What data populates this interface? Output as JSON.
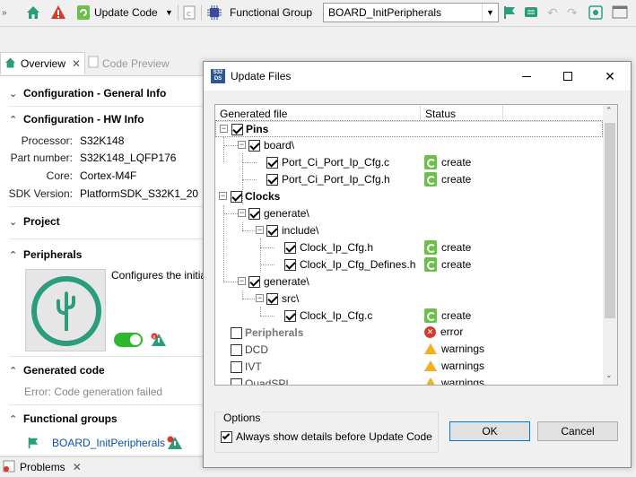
{
  "toolbar": {
    "update_code_label": "Update Code",
    "functional_group_label": "Functional Group",
    "functional_group_value": "BOARD_InitPeripherals"
  },
  "editor_tabs": {
    "overview": "Overview",
    "code_preview": "Code Preview"
  },
  "overview": {
    "sections": {
      "general_info": "Configuration - General Info",
      "hw_info": "Configuration - HW Info",
      "project": "Project",
      "peripherals": "Peripherals",
      "generated_code": "Generated code",
      "functional_groups": "Functional groups"
    },
    "hw_info": [
      {
        "key": "Processor:",
        "value": "S32K148"
      },
      {
        "key": "Part number:",
        "value": "S32K148_LQFP176"
      },
      {
        "key": "Core:",
        "value": "Cortex-M4F"
      },
      {
        "key": "SDK Version:",
        "value": "PlatformSDK_S32K1_20"
      }
    ],
    "peripherals_desc": "Configures the initia",
    "generated_code_status": "Error: Code generation failed",
    "functional_group_item": "BOARD_InitPeripherals",
    "peripherals_toggle_on": true
  },
  "bottom_tab": {
    "problems": "Problems"
  },
  "dialog": {
    "title": "Update Files",
    "app_icon_text": "S32 DS",
    "columns": {
      "file": "Generated file",
      "status": "Status"
    },
    "rows": [
      {
        "label": "Pins",
        "bold": true,
        "checked": true,
        "status": "",
        "kind": ""
      },
      {
        "label": "board\\",
        "bold": false,
        "checked": true,
        "status": "",
        "kind": ""
      },
      {
        "label": "Port_Ci_Port_Ip_Cfg.c",
        "bold": false,
        "checked": true,
        "status": "create",
        "kind": "create"
      },
      {
        "label": "Port_Ci_Port_Ip_Cfg.h",
        "bold": false,
        "checked": true,
        "status": "create",
        "kind": "create"
      },
      {
        "label": "Clocks",
        "bold": true,
        "checked": true,
        "status": "",
        "kind": ""
      },
      {
        "label": "generate\\",
        "bold": false,
        "checked": true,
        "status": "",
        "kind": ""
      },
      {
        "label": "include\\",
        "bold": false,
        "checked": true,
        "status": "",
        "kind": ""
      },
      {
        "label": "Clock_Ip_Cfg.h",
        "bold": false,
        "checked": true,
        "status": "create",
        "kind": "create"
      },
      {
        "label": "Clock_Ip_Cfg_Defines.h",
        "bold": false,
        "checked": true,
        "status": "create",
        "kind": "create"
      },
      {
        "label": "generate\\",
        "bold": false,
        "checked": true,
        "status": "",
        "kind": ""
      },
      {
        "label": "src\\",
        "bold": false,
        "checked": true,
        "status": "",
        "kind": ""
      },
      {
        "label": "Clock_Ip_Cfg.c",
        "bold": false,
        "checked": true,
        "status": "create",
        "kind": "create"
      },
      {
        "label": "Peripherals",
        "bold": true,
        "checked": false,
        "status": "error",
        "kind": "error"
      },
      {
        "label": "DCD",
        "bold": true,
        "checked": false,
        "status": "warnings",
        "kind": "warning"
      },
      {
        "label": "IVT",
        "bold": true,
        "checked": false,
        "status": "warnings",
        "kind": "warning"
      },
      {
        "label": "QuadSPI",
        "bold": true,
        "checked": false,
        "status": "warnings",
        "kind": "warning"
      }
    ],
    "options_label": "Options",
    "always_show_label": "Always show details before Update Code",
    "always_show_checked": true,
    "ok_label": "OK",
    "cancel_label": "Cancel"
  },
  "colors": {
    "accent_green": "#6cc04a",
    "brand_teal": "#2a9d7d",
    "error_red": "#d9392b",
    "warning_amber": "#f2b01e",
    "link_blue": "#0b4fa3"
  }
}
